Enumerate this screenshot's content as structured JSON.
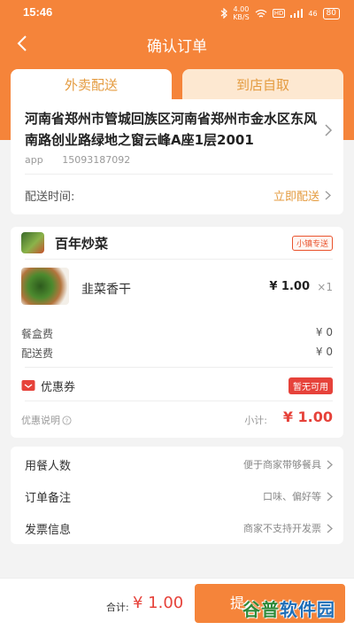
{
  "status_bar": {
    "time": "15:46",
    "net_speed": "4.00",
    "net_unit": "KB/S",
    "signal": "46",
    "battery": "80"
  },
  "nav": {
    "title": "确认订单"
  },
  "tabs": [
    {
      "label": "外卖配送"
    },
    {
      "label": "到店自取"
    }
  ],
  "address": {
    "text": "河南省郑州市管城回族区河南省郑州市金水区东风南路创业路绿地之窗云峰A座1层2001",
    "contact_name": "app",
    "contact_phone": "15093187092",
    "delivery_time_label": "配送时间:",
    "delivery_time_value": "立即配送"
  },
  "order": {
    "shop_name": "百年炒菜",
    "shop_badge": "小镇专送",
    "items": [
      {
        "name": "韭菜香干",
        "price": "¥ 1.00",
        "qty": "×1"
      }
    ],
    "fees": [
      {
        "label": "餐盒费",
        "value": "¥ 0"
      },
      {
        "label": "配送费",
        "value": "¥ 0"
      }
    ],
    "coupon_label": "优惠券",
    "coupon_status": "暂无可用",
    "discount_note": "优惠说明",
    "subtotal_label": "小计:",
    "subtotal_value": "¥ 1.00"
  },
  "extras": [
    {
      "label": "用餐人数",
      "value": "便于商家带够餐具"
    },
    {
      "label": "订单备注",
      "value": "口味、偏好等"
    },
    {
      "label": "发票信息",
      "value": "商家不支持开发票"
    }
  ],
  "footer": {
    "total_label": "合计:",
    "total_value": "¥ 1.00",
    "submit_label": "提"
  },
  "watermark": {
    "part_a": "谷普",
    "part_b": "软件园"
  },
  "colors": {
    "accent": "#f5843a",
    "price_red": "#e6423a",
    "tab_text": "#e49b3f"
  }
}
